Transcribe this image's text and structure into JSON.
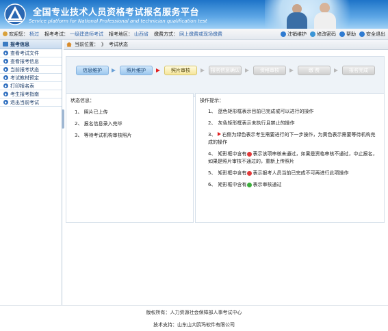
{
  "header": {
    "title_zh": "全国专业技术人员资格考试报名服务平台",
    "title_en": "Service platform for National Professional and technician qualification test",
    "links": [
      {
        "label": "注销维护",
        "icon": "logout-icon",
        "color": "#2f7bd1"
      },
      {
        "label": "修改密码",
        "icon": "key-icon",
        "color": "#3b95d6"
      },
      {
        "label": "帮助",
        "icon": "help-icon",
        "color": "#2f7bd1"
      },
      {
        "label": "安全退出",
        "icon": "exit-icon",
        "color": "#2f7bd1"
      }
    ]
  },
  "infobar": {
    "welcome_label": "欢迎您：",
    "welcome_value": "杨过",
    "exam_label": "报考考试：",
    "exam_value": "一级建造师考试",
    "region_label": "报考地区：",
    "region_value": "山西省",
    "fee_label": "缴费方式：",
    "fee_value": "网上缴费或现场缴费"
  },
  "sidebar": {
    "title": "报考信息",
    "items": [
      {
        "label": "查看考试文件"
      },
      {
        "label": "查看报考信息"
      },
      {
        "label": "当前报考状态"
      },
      {
        "label": "考试教材预定"
      },
      {
        "label": "打印报名表"
      },
      {
        "label": "考生报考指南"
      },
      {
        "label": "退出当前考试"
      }
    ]
  },
  "breadcrumb": {
    "label": "当前位置：",
    "sep": "》",
    "current": "考试状态"
  },
  "steps": [
    {
      "label": "信息维护",
      "state": "active"
    },
    {
      "label": "照片维护",
      "state": "active"
    },
    {
      "label": "照片审核",
      "state": "current"
    },
    {
      "label": "报名信息确认",
      "state": "pending"
    },
    {
      "label": "资格审核",
      "state": "pending"
    },
    {
      "label": "缴 费",
      "state": "pending"
    },
    {
      "label": "报名完成",
      "state": "pending"
    }
  ],
  "status": {
    "title": "状态信息：",
    "lines": [
      "1、 照片已上传",
      "2、 报名信息录入完毕",
      "3、 等待考试机构审核照片"
    ]
  },
  "hints": {
    "title": "操作提示：",
    "items": [
      {
        "num": "1、",
        "text": "蓝色矩形框表示目前已完成或可以进行的操作"
      },
      {
        "num": "2、",
        "text": "灰色矩形框表示未执行且禁止的操作"
      },
      {
        "num": "3、",
        "text": "右侧为绿色表示考生需要进行的下一步操作，为黄色表示需要等待机构完成的操作"
      },
      {
        "num": "4、",
        "pre": "矩形框中含有",
        "text": "表示该项审核未通过，如果是资格审核不通过，中止报名，如果是照片审核不通过的，重新上传照片"
      },
      {
        "num": "5、",
        "pre": "矩形框中含有",
        "text": "表示报考人员当前已完成不可再进行此项操作"
      },
      {
        "num": "6、",
        "pre": "矩形框中含有",
        "text": "表示审核通过"
      }
    ]
  },
  "footer": {
    "owner": "版权所有：人力资源社会保障部人事考试中心",
    "support": "技术支持：山东山大鸥玛软件有限公司"
  }
}
